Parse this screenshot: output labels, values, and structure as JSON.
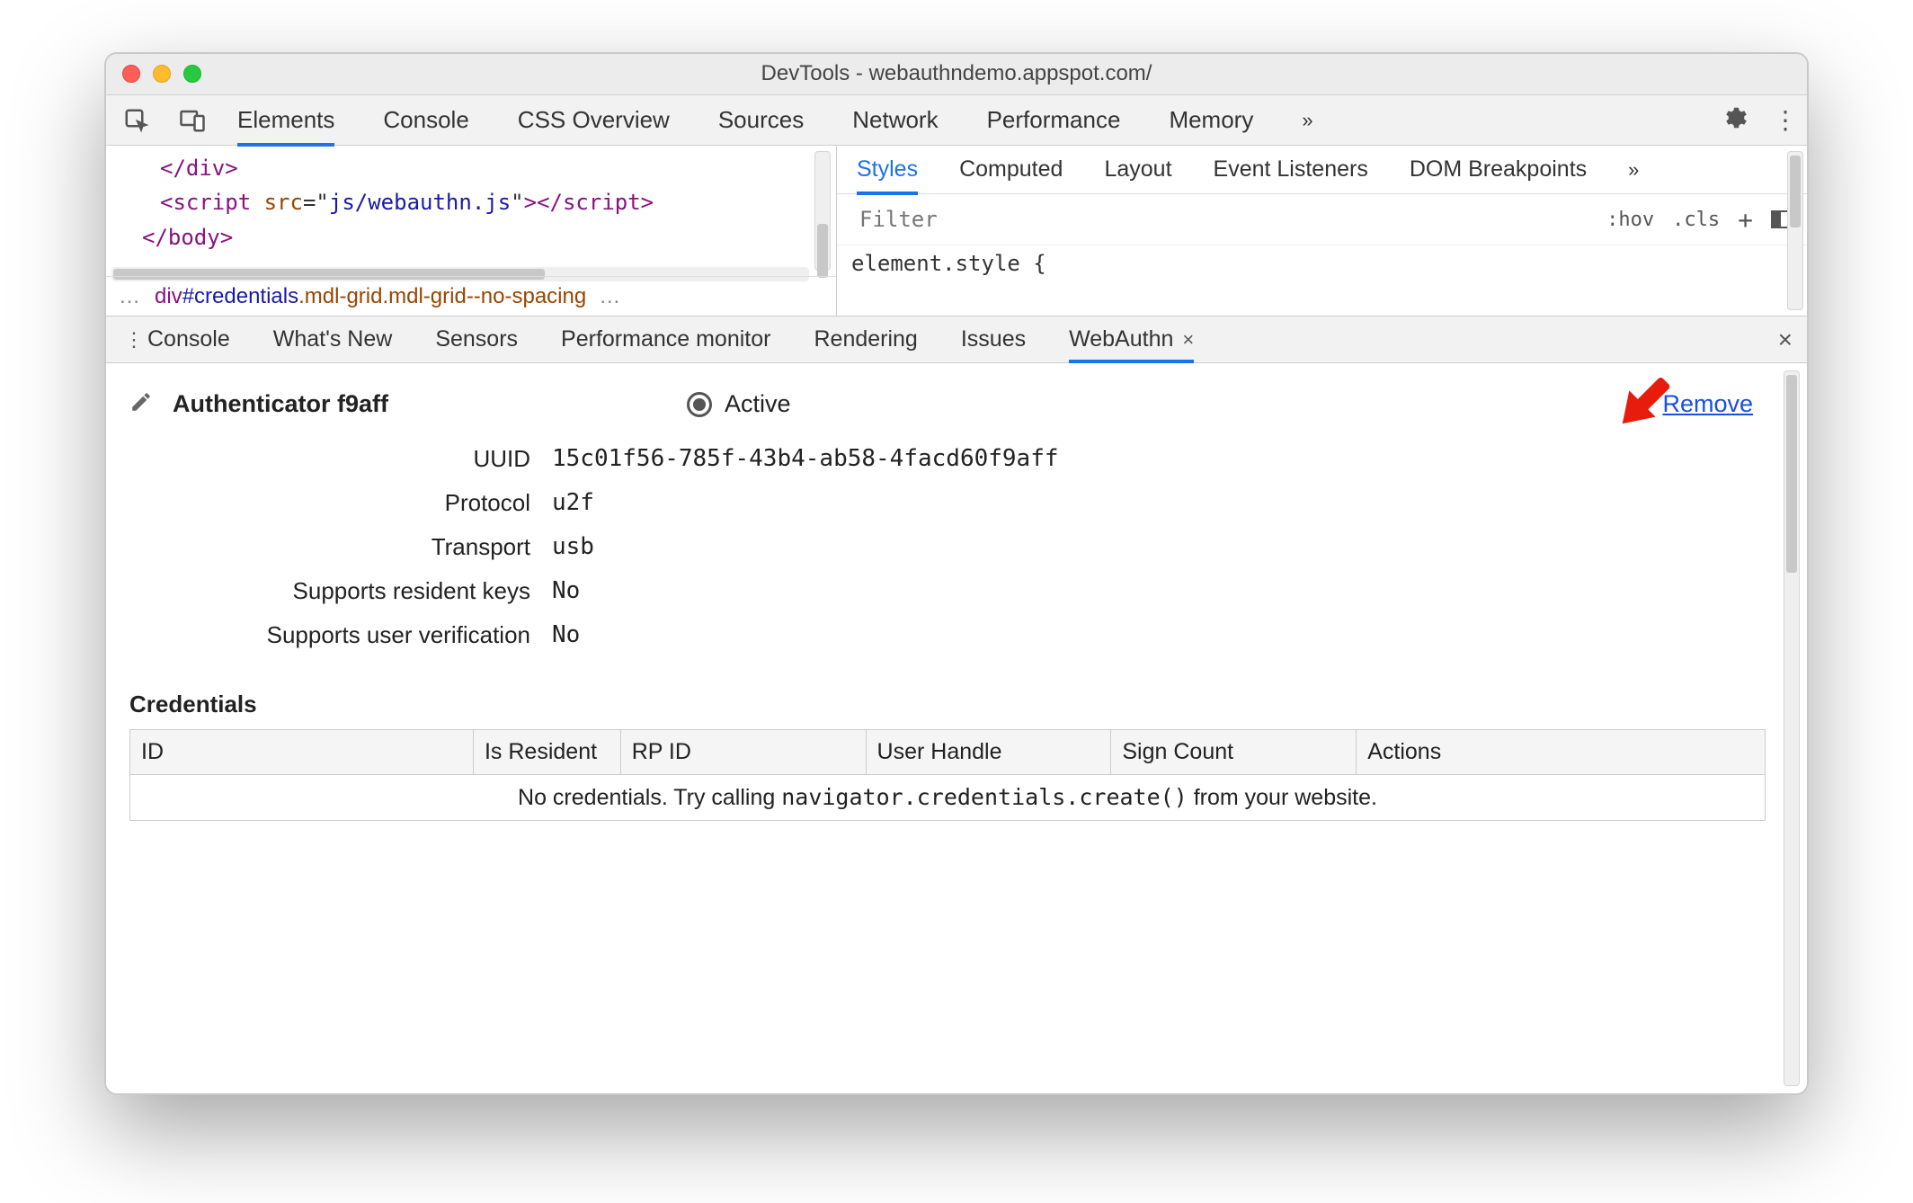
{
  "window_title": "DevTools - webauthndemo.appspot.com/",
  "main_tabs": [
    "Elements",
    "Console",
    "CSS Overview",
    "Sources",
    "Network",
    "Performance",
    "Memory"
  ],
  "main_tabs_more_glyph": "»",
  "dom_snippet": {
    "lines": [
      {
        "indent": 1,
        "html": "</div>"
      },
      {
        "indent": 1,
        "html": "<script src=\"js/webauthn.js\"></script>"
      },
      {
        "indent": 0,
        "html": "</body>"
      }
    ]
  },
  "breadcrumb": {
    "tag": "div",
    "id": "#credentials",
    "classes": ".mdl-grid.mdl-grid--no-spacing"
  },
  "styles_pane": {
    "tabs": [
      "Styles",
      "Computed",
      "Layout",
      "Event Listeners",
      "DOM Breakpoints"
    ],
    "more_glyph": "»",
    "filter_placeholder": "Filter",
    "controls": [
      ":hov",
      ".cls",
      "+",
      "◧"
    ],
    "body": "element.style {"
  },
  "drawer": {
    "tabs": [
      "Console",
      "What's New",
      "Sensors",
      "Performance monitor",
      "Rendering",
      "Issues",
      "WebAuthn"
    ],
    "active_tab": "WebAuthn"
  },
  "webauthn": {
    "title": "Authenticator f9aff",
    "active_label": "Active",
    "remove_label": "Remove",
    "rows": [
      {
        "label": "UUID",
        "value": "15c01f56-785f-43b4-ab58-4facd60f9aff"
      },
      {
        "label": "Protocol",
        "value": "u2f"
      },
      {
        "label": "Transport",
        "value": "usb"
      },
      {
        "label": "Supports resident keys",
        "value": "No"
      },
      {
        "label": "Supports user verification",
        "value": "No"
      }
    ],
    "credentials_header": "Credentials",
    "table": {
      "columns": [
        "ID",
        "Is Resident",
        "RP ID",
        "User Handle",
        "Sign Count",
        "Actions"
      ],
      "empty_prefix": "No credentials. Try calling ",
      "empty_code": "navigator.credentials.create()",
      "empty_suffix": " from your website."
    }
  }
}
